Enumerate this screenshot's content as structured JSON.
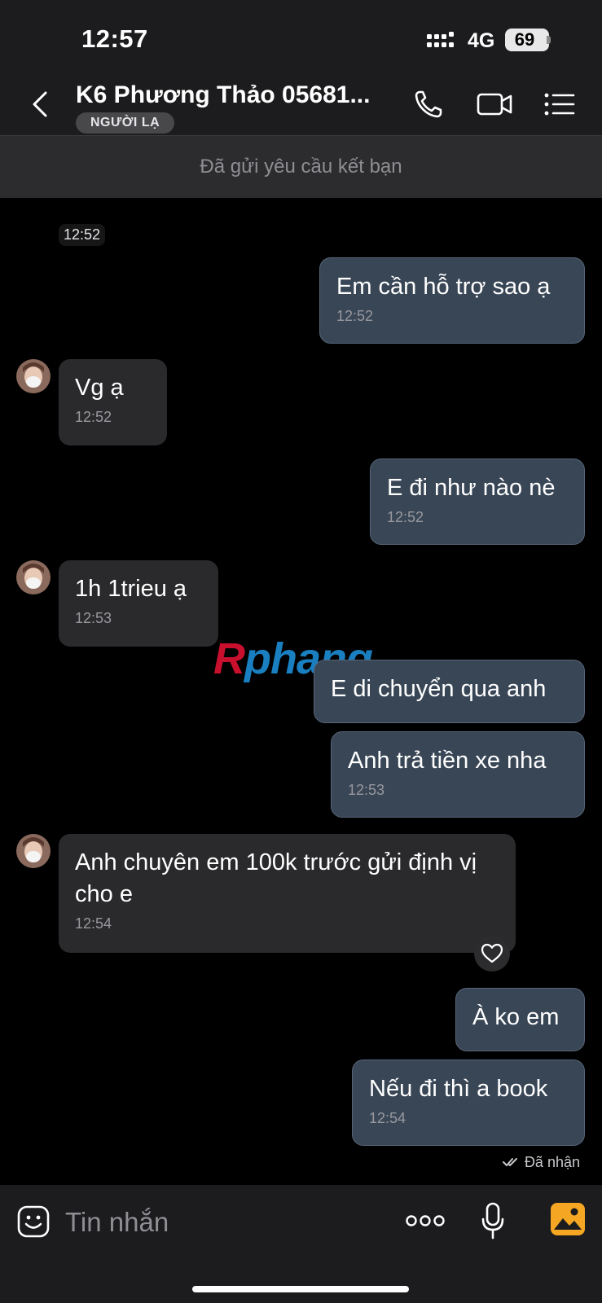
{
  "status_bar": {
    "time": "12:57",
    "network": "4G",
    "battery": "69"
  },
  "header": {
    "title": "K6 Phương Thảo 05681...",
    "badge": "NGƯỜI LẠ"
  },
  "friend_request": {
    "text": "Đã gửi yêu cầu kết bạn"
  },
  "chat": {
    "day_time": "12:52",
    "messages": [
      {
        "direction": "out",
        "text": "Em cần hỗ trợ sao ạ",
        "time": "12:52"
      },
      {
        "direction": "in",
        "text": "Vg ạ",
        "time": "12:52"
      },
      {
        "direction": "out",
        "text": "E đi như nào nè",
        "time": "12:52"
      },
      {
        "direction": "in",
        "text": "1h 1trieu ạ",
        "time": "12:53"
      },
      {
        "direction": "out",
        "text": "E di chuyển qua anh",
        "time": ""
      },
      {
        "direction": "out",
        "text": "Anh trả tiền xe nha",
        "time": "12:53"
      },
      {
        "direction": "in",
        "text": "Anh chuyên em 100k trước gửi định vị cho e",
        "time": "12:54"
      },
      {
        "direction": "out",
        "text": "À ko em",
        "time": ""
      },
      {
        "direction": "out",
        "text": "Nếu đi thì a book",
        "time": "12:54"
      }
    ],
    "read_status": "Đã nhận"
  },
  "watermark": {
    "part1": "R",
    "part2": "phang"
  },
  "composer": {
    "placeholder": "Tin nhắn"
  },
  "colors": {
    "outgoing_bubble": "#394656",
    "incoming_bubble": "#2a2a2c",
    "background": "#000000"
  },
  "icons": [
    "back-chevron-icon",
    "phone-icon",
    "video-call-icon",
    "menu-list-icon",
    "emoji-icon",
    "more-dots-icon",
    "microphone-icon",
    "image-gallery-icon",
    "heart-icon",
    "double-check-icon"
  ]
}
